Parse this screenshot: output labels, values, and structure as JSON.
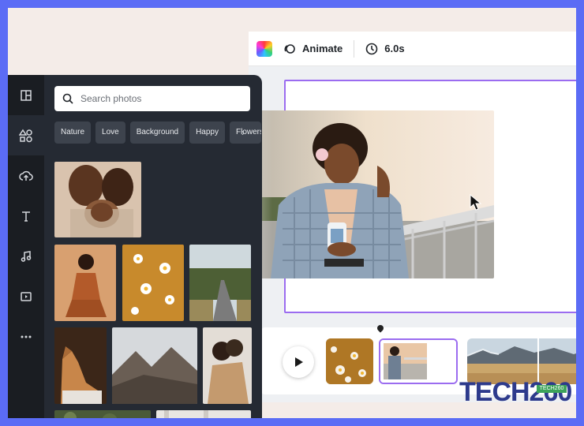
{
  "toolbar": {
    "animate_label": "Animate",
    "duration_label": "6.0s"
  },
  "panel": {
    "search_placeholder": "Search photos",
    "chips": [
      "Nature",
      "Love",
      "Background",
      "Happy",
      "Flowers"
    ],
    "rail_icons": [
      "layout-icon",
      "elements-icon",
      "upload-icon",
      "text-icon",
      "music-icon",
      "video-icon",
      "more-icon"
    ]
  },
  "watermark": {
    "text": "TECH260",
    "tag": "TECH260"
  },
  "colors": {
    "outer_border": "#5b6cf5",
    "panel_bg": "#252a33",
    "rail_bg": "#1a1d22",
    "selection_purple": "#9b6cf0"
  }
}
